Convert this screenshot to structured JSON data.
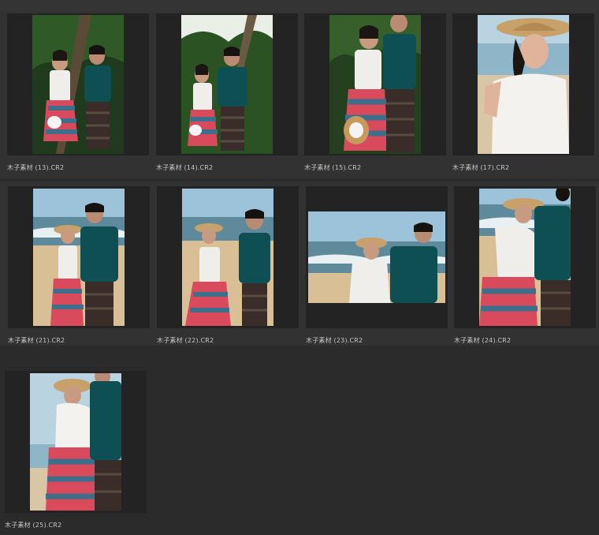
{
  "thumbnails": [
    {
      "filename": "木子素材 (13).CR2",
      "scene": "palm trees, couple standing"
    },
    {
      "filename": "木子素材 (14).CR2",
      "scene": "palm trees, couple standing"
    },
    {
      "filename": "木子素材 (15).CR2",
      "scene": "palm trees, couple close"
    },
    {
      "filename": "木子素材 (17).CR2",
      "scene": "beach, woman in hat portrait"
    },
    {
      "filename": "木子素材 (21).CR2",
      "scene": "beach, couple"
    },
    {
      "filename": "木子素材 (22).CR2",
      "scene": "beach, couple"
    },
    {
      "filename": "木子素材 (23).CR2",
      "scene": "beach, couple landscape"
    },
    {
      "filename": "木子素材 (24).CR2",
      "scene": "beach, couple"
    },
    {
      "filename": "木子素材 (25).CR2",
      "scene": "beach, couple close"
    }
  ],
  "colors": {
    "background": "#2b2b2b",
    "frame": "#232323",
    "caption_text": "#c8c8c8",
    "shirt_teal": "#0e4f54",
    "sky": "#9cc3da",
    "sand": "#d8bf96"
  }
}
